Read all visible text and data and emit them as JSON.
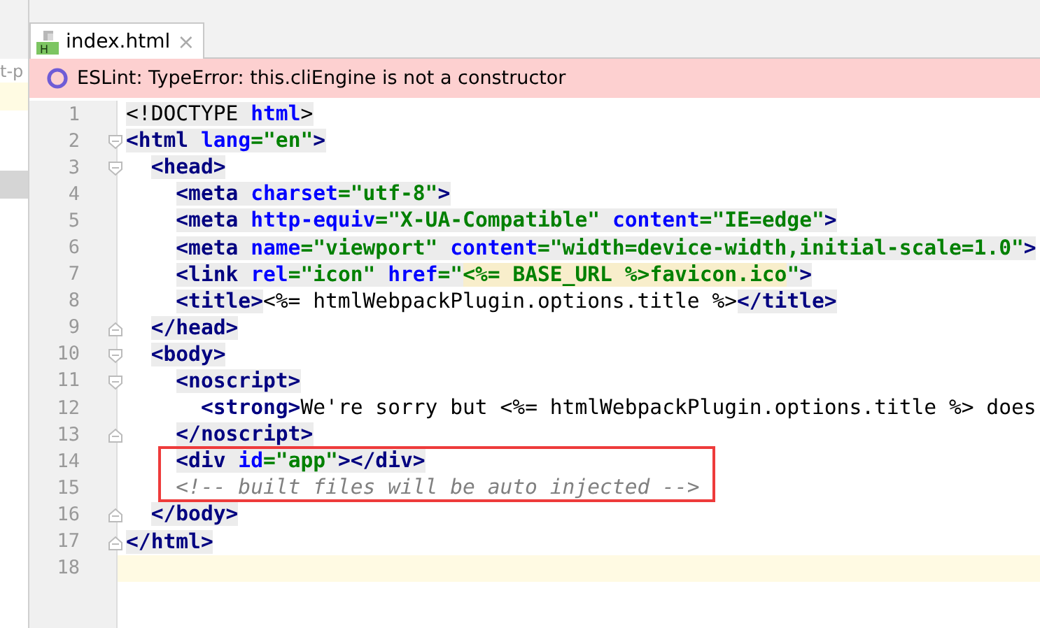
{
  "project_panel": {
    "visible_text": "t-p"
  },
  "tabs": [
    {
      "label": "index.html",
      "icon_label": "H",
      "close": "×",
      "selected": true
    }
  ],
  "banner": {
    "kind": "error",
    "message": "ESLint: TypeError: this.cliEngine is not a constructor"
  },
  "lines": [
    {
      "number": "1",
      "parts": [
        {
          "highlight": true,
          "tokens": [
            {
              "kind": "plain",
              "text": "<!DOCTYPE "
            },
            {
              "kind": "attr",
              "text": "html"
            },
            {
              "kind": "plain",
              "text": ">"
            }
          ]
        }
      ]
    },
    {
      "number": "2",
      "kind": "opener",
      "parts": [
        {
          "highlight": true,
          "tokens": [
            {
              "kind": "tag",
              "text": "<html "
            },
            {
              "kind": "attr",
              "text": "lang"
            },
            {
              "kind": "value",
              "text": "=\"en\""
            },
            {
              "kind": "tag",
              "text": ">"
            }
          ]
        }
      ],
      "children": [
        {
          "number": "3",
          "kind": "opener",
          "parts": [
            {
              "highlight": true,
              "tokens": [
                {
                  "kind": "tag",
                  "text": "<head>"
                }
              ]
            }
          ],
          "children": [
            {
              "number": "4",
              "parts": [
                {
                  "highlight": true,
                  "tokens": [
                    {
                      "kind": "tag",
                      "text": "<meta "
                    },
                    {
                      "kind": "attr",
                      "text": "charset"
                    },
                    {
                      "kind": "value",
                      "text": "=\"utf-8\""
                    },
                    {
                      "kind": "tag",
                      "text": ">"
                    }
                  ]
                }
              ]
            },
            {
              "number": "5",
              "parts": [
                {
                  "highlight": true,
                  "tokens": [
                    {
                      "kind": "tag",
                      "text": "<meta "
                    },
                    {
                      "kind": "attr",
                      "text": "http-equiv"
                    },
                    {
                      "kind": "value",
                      "text": "=\"X-UA-Compatible\" "
                    },
                    {
                      "kind": "attr",
                      "text": "content"
                    },
                    {
                      "kind": "value",
                      "text": "=\"IE=edge\""
                    },
                    {
                      "kind": "tag",
                      "text": ">"
                    }
                  ]
                }
              ]
            },
            {
              "number": "6",
              "parts": [
                {
                  "highlight": true,
                  "tokens": [
                    {
                      "kind": "tag",
                      "text": "<meta "
                    },
                    {
                      "kind": "attr",
                      "text": "name"
                    },
                    {
                      "kind": "value",
                      "text": "=\"viewport\" "
                    },
                    {
                      "kind": "attr",
                      "text": "content"
                    },
                    {
                      "kind": "value",
                      "text": "=\"width=device-width,initial-scale=1.0\""
                    },
                    {
                      "kind": "tag",
                      "text": ">"
                    }
                  ]
                }
              ]
            },
            {
              "number": "7",
              "parts": [
                {
                  "highlight": true,
                  "tokens": [
                    {
                      "kind": "tag",
                      "text": "<link "
                    },
                    {
                      "kind": "attr",
                      "text": "rel"
                    },
                    {
                      "kind": "value",
                      "text": "=\"icon\" "
                    },
                    {
                      "kind": "attr",
                      "text": "href"
                    },
                    {
                      "kind": "value",
                      "text": "=\""
                    },
                    {
                      "kind": "template",
                      "text": "<%= BASE_URL %>favicon.ico"
                    },
                    {
                      "kind": "value",
                      "text": "\""
                    },
                    {
                      "kind": "tag",
                      "text": ">"
                    }
                  ]
                }
              ]
            },
            {
              "number": "8",
              "parts": [
                {
                  "highlight": true,
                  "tokens": [
                    {
                      "kind": "tag",
                      "text": "<title>"
                    }
                  ]
                },
                {
                  "highlight": false,
                  "tokens": [
                    {
                      "kind": "plain",
                      "text": "<%= htmlWebpackPlugin.options.title %>"
                    }
                  ]
                },
                {
                  "highlight": true,
                  "tokens": [
                    {
                      "kind": "tag",
                      "text": "</title>"
                    }
                  ]
                }
              ]
            }
          ]
        },
        {
          "number": "9",
          "kind": "closer",
          "parts": [
            {
              "highlight": true,
              "tokens": [
                {
                  "kind": "tag",
                  "text": "</head>"
                }
              ]
            }
          ]
        },
        {
          "number": "10",
          "kind": "opener",
          "parts": [
            {
              "highlight": true,
              "tokens": [
                {
                  "kind": "tag",
                  "text": "<body>"
                }
              ]
            }
          ],
          "children": [
            {
              "number": "11",
              "kind": "opener",
              "parts": [
                {
                  "highlight": true,
                  "tokens": [
                    {
                      "kind": "tag",
                      "text": "<noscript>"
                    }
                  ]
                }
              ],
              "children": [
                {
                  "number": "12",
                  "parts": [
                    {
                      "highlight": false,
                      "tokens": [
                        {
                          "kind": "tag",
                          "text": "<strong>"
                        },
                        {
                          "kind": "plain",
                          "text": "We're sorry but <%= htmlWebpackPlugin.options.title %> does"
                        }
                      ]
                    }
                  ]
                }
              ]
            },
            {
              "number": "13",
              "kind": "closer",
              "parts": [
                {
                  "highlight": true,
                  "tokens": [
                    {
                      "kind": "tag",
                      "text": "</noscript>"
                    }
                  ]
                }
              ]
            },
            {
              "number": "14",
              "boxed": true,
              "parts": [
                {
                  "highlight": true,
                  "tokens": [
                    {
                      "kind": "tag",
                      "text": "<div "
                    },
                    {
                      "kind": "attr",
                      "text": "id"
                    },
                    {
                      "kind": "value",
                      "text": "=\"app\""
                    },
                    {
                      "kind": "tag",
                      "text": "></div>"
                    }
                  ]
                }
              ]
            },
            {
              "number": "15",
              "boxed": true,
              "parts": [
                {
                  "highlight": false,
                  "tokens": [
                    {
                      "kind": "comment",
                      "text": "<!-- built files will be auto injected -->"
                    }
                  ]
                }
              ]
            }
          ]
        },
        {
          "number": "16",
          "kind": "closer",
          "parts": [
            {
              "highlight": true,
              "tokens": [
                {
                  "kind": "tag",
                  "text": "</body>"
                }
              ]
            }
          ]
        }
      ]
    },
    {
      "number": "17",
      "kind": "closer",
      "parts": [
        {
          "highlight": true,
          "tokens": [
            {
              "kind": "tag",
              "text": "</html>"
            }
          ]
        }
      ]
    },
    {
      "number": "18",
      "current": true
    }
  ]
}
